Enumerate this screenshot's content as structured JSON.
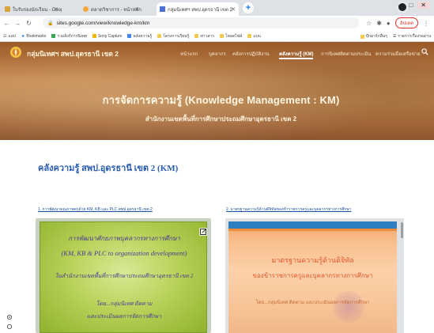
{
  "browser": {
    "tabs": [
      {
        "label": "ใบรับรองนักเรียน - Google ไดรฟ์",
        "icon": "drive-icon"
      },
      {
        "label": "ตลาดวิชาการ - หน้าหลัก",
        "icon": "site-icon"
      },
      {
        "label": "กลุ่มนิเทศฯ สพป.อุดรธานี เขต 2",
        "icon": "google-sites-icon"
      }
    ],
    "new_tab": "+",
    "window_controls": [
      "—",
      "□",
      "✕"
    ],
    "address": "sites.google.com/view/knowledge-km/km",
    "update_label": "อัปเดต",
    "bookmarks": [
      {
        "label": "แอป",
        "icon": "apps-icon"
      },
      {
        "label": "Bookmarks",
        "icon": "star-icon"
      },
      {
        "label": "รวมลิงก์การนิเทศ",
        "icon": "folder-icon"
      },
      {
        "label": "Sony Capture",
        "icon": "folder-icon"
      },
      {
        "label": "คลังความรู้",
        "icon": "folder-icon"
      },
      {
        "label": "โครงการเรียนรู้",
        "icon": "folder-icon"
      },
      {
        "label": "ข่าวสาร",
        "icon": "folder-icon"
      },
      {
        "label": "โหลดไฟล์",
        "icon": "folder-icon"
      },
      {
        "label": "แบบ",
        "icon": "folder-icon"
      }
    ],
    "bookmarks_right": [
      {
        "label": "บุ๊กมาร์กอื่นๆ",
        "icon": "folder-icon"
      },
      {
        "label": "รายการเรื่องรออ่าน",
        "icon": "reading-list-icon"
      }
    ]
  },
  "site": {
    "name": "กลุ่มนิเทศฯ สพป.อุดรธานี เขต 2",
    "nav": [
      "หน้าแรก",
      "บุคลากร",
      "คลังการปฏิบัติงาน",
      "คลังความรู้ (KM)",
      "การนิเทศติดตามประเมิน",
      "ความร่วมมือเครือข่าย"
    ],
    "hero_title": "การจัดการความรู้ (Knowledge Management : KM)",
    "hero_subtitle": "สำนักงานเขตพื้นที่การศึกษาประถมศึกษาอุดรธานี เขต 2"
  },
  "page": {
    "heading": "คลังความรู้ สพป.อุดรธานี เขต 2 (KM)",
    "captions": [
      "1. การพัฒนาคุณภาพครูด้วย KM, KB และ PLC สพป.อุดรธานี เขต 2",
      "2. มาตรฐานความรู้ด้านดิจิทัลของข้าราชการครูและบุคลากรทางการศึกษา"
    ],
    "card_left_lines": [
      "การพัฒนาศักยภาพบุคลากรทางการศึกษา",
      "(KM, KB & PLC to organization development)",
      "ในสำนักงานเขตพื้นที่การศึกษาประถมศึกษาอุดรธานี เขต 2",
      "โดย...กลุ่มนิเทศ ติดตาม",
      "และประเมินผลการจัดการศึกษา"
    ],
    "card_right_lines": [
      "มาตรฐานความรู้ด้านดิจิทัล",
      "ของข้าราชการครูและบุคลากรทางการศึกษา",
      "โดย...กลุ่มนิเทศ ติดตาม และประเมินผลการจัดการศึกษา"
    ]
  },
  "colors": {
    "hero": "#b0713b",
    "heading": "#2a5db0",
    "card_left": "#b9d35a",
    "card_right": "#fbd1aa"
  }
}
